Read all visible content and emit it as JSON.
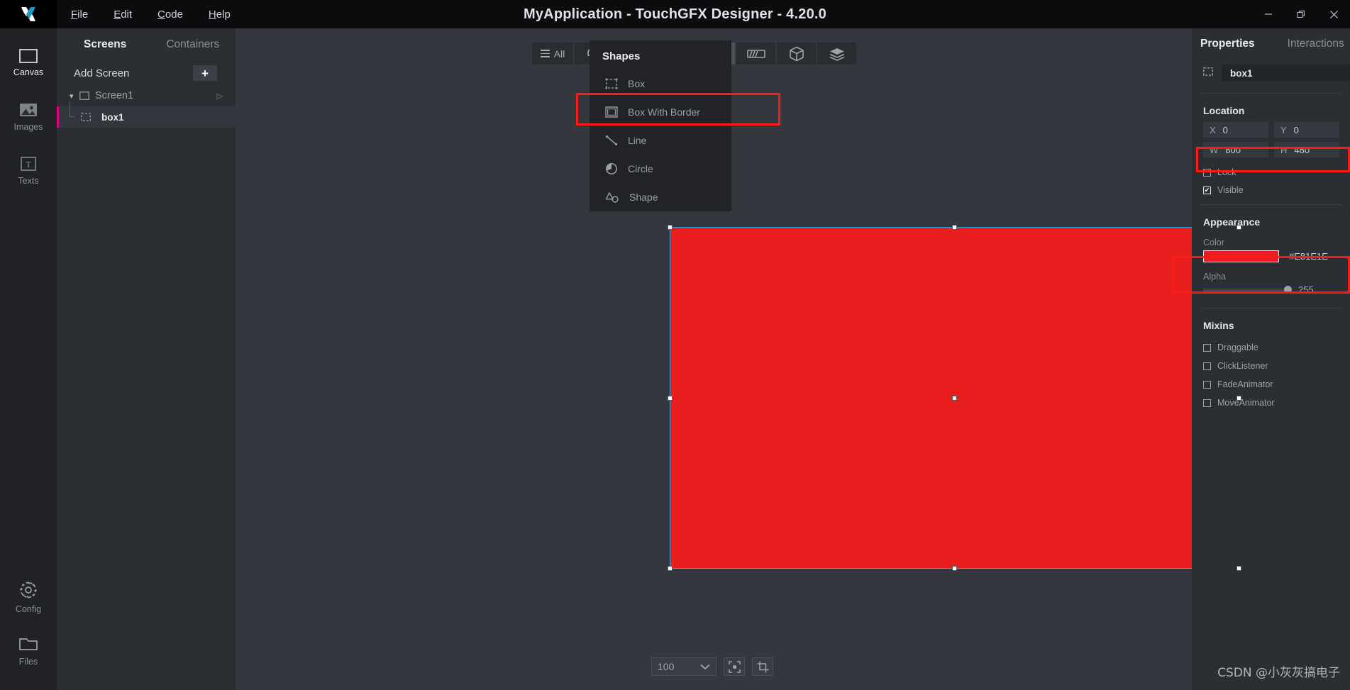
{
  "window": {
    "title": "MyApplication - TouchGFX Designer - 4.20.0",
    "logo_icon": "touchgfx-x-logo",
    "controls": {
      "minimize": "minimize-icon",
      "restore": "restore-icon",
      "close": "close-icon"
    }
  },
  "menubar": {
    "items": [
      {
        "mnemonic": "F",
        "rest": "ile"
      },
      {
        "mnemonic": "E",
        "rest": "dit"
      },
      {
        "mnemonic": "C",
        "rest": "ode"
      },
      {
        "mnemonic": "H",
        "rest": "elp"
      }
    ]
  },
  "rail": {
    "items": [
      {
        "label": "Canvas",
        "icon": "canvas-icon",
        "active": true
      },
      {
        "label": "Images",
        "icon": "images-icon",
        "active": false
      },
      {
        "label": "Texts",
        "icon": "texts-icon",
        "active": false
      }
    ],
    "bottom_items": [
      {
        "label": "Config",
        "icon": "gear-icon"
      },
      {
        "label": "Files",
        "icon": "folder-icon"
      }
    ]
  },
  "tree_panel": {
    "tabs": {
      "screens": "Screens",
      "containers": "Containers"
    },
    "add_screen_label": "Add Screen",
    "add_button_glyph": "+",
    "screen": {
      "label": "Screen1",
      "icon": "screen-icon",
      "caret": "▾",
      "play": "▷"
    },
    "child": {
      "label": "box1",
      "icon": "box-icon"
    }
  },
  "toolbar": {
    "buttons": [
      {
        "name": "all-filter",
        "label": "All",
        "icon": "hamburger-icon",
        "active": false
      },
      {
        "name": "interaction-widgets",
        "label": "",
        "icon": "touch-pointer-icon",
        "active": false
      },
      {
        "name": "image-widgets",
        "label": "",
        "icon": "picture-icon",
        "active": false
      },
      {
        "name": "container-widgets",
        "label": "",
        "icon": "layers-icon",
        "active": false
      },
      {
        "name": "shape-widgets",
        "label": "",
        "icon": "shapes-icon",
        "active": true
      },
      {
        "name": "progress-widgets",
        "label": "",
        "icon": "progress-bar-icon",
        "active": false
      },
      {
        "name": "3d-widgets",
        "label": "",
        "icon": "cube-icon",
        "active": false
      },
      {
        "name": "misc-widgets",
        "label": "",
        "icon": "stack-icon",
        "active": false
      }
    ]
  },
  "shapes_menu": {
    "title": "Shapes",
    "items": [
      {
        "label": "Box",
        "icon": "box-dashed-icon",
        "highlighted": true
      },
      {
        "label": "Box With Border",
        "icon": "box-border-icon",
        "highlighted": false
      },
      {
        "label": "Line",
        "icon": "line-icon",
        "highlighted": false
      },
      {
        "label": "Circle",
        "icon": "circle-icon",
        "highlighted": false
      },
      {
        "label": "Shape",
        "icon": "shape-icon",
        "highlighted": false
      }
    ]
  },
  "canvas": {
    "box_color": "#E81E1E",
    "selection_color": "#29A6DD",
    "zoom": {
      "value": "100",
      "chevron": "chevron-down-icon"
    },
    "fit_button_icon": "fit-to-screen-icon",
    "crop_button_icon": "crop-icon"
  },
  "properties": {
    "tabs": {
      "active": "Properties",
      "inactive": "Interactions"
    },
    "name": {
      "icon": "box-icon",
      "value": "box1"
    },
    "location": {
      "title": "Location",
      "x": {
        "label": "X",
        "value": "0"
      },
      "y": {
        "label": "Y",
        "value": "0"
      },
      "w": {
        "label": "W",
        "value": "800"
      },
      "h": {
        "label": "H",
        "value": "480"
      },
      "lock": {
        "label": "Lock",
        "checked": false
      },
      "visible": {
        "label": "Visible",
        "checked": true
      }
    },
    "appearance": {
      "title": "Appearance",
      "color_label": "Color",
      "color_hex": "#E81E1E",
      "alpha_label": "Alpha",
      "alpha_value": "255"
    },
    "mixins": {
      "title": "Mixins",
      "items": [
        {
          "label": "Draggable",
          "checked": false
        },
        {
          "label": "ClickListener",
          "checked": false
        },
        {
          "label": "FadeAnimator",
          "checked": false
        },
        {
          "label": "MoveAnimator",
          "checked": false
        }
      ]
    }
  },
  "annotations": {
    "accent_color": "#FF1A14",
    "highlight_box_menu": "Box menu item highlighted",
    "highlight_size_fields": "W/H fields highlighted",
    "highlight_color_field": "Color swatch highlighted"
  },
  "watermark": {
    "text": "CSDN @小灰灰搞电子"
  }
}
